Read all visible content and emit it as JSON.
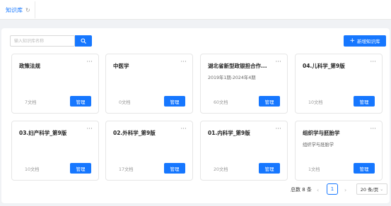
{
  "tabs": [
    {
      "label": "知识库",
      "refresh_icon": "refresh-icon"
    }
  ],
  "search": {
    "placeholder": "输入知识库名称"
  },
  "toolbar": {
    "new_label": "新增知识库"
  },
  "cards": [
    {
      "title": "政策法规",
      "description": "",
      "count": "7文档",
      "manage": "管理"
    },
    {
      "title": "中医学",
      "description": "",
      "count": "0文档",
      "manage": "管理"
    },
    {
      "title": "湖北省新型政银担合作...",
      "description": "2019年1期-2024年4期",
      "count": "60文档",
      "manage": "管理"
    },
    {
      "title": "04.儿科学_第9版",
      "description": "",
      "count": "10文档",
      "manage": "管理"
    },
    {
      "title": "03.妇产科学_第9版",
      "description": "",
      "count": "10文档",
      "manage": "管理"
    },
    {
      "title": "02.外科学_第9版",
      "description": "",
      "count": "17文档",
      "manage": "管理"
    },
    {
      "title": "01.内科学_第9版",
      "description": "",
      "count": "20文档",
      "manage": "管理"
    },
    {
      "title": "组织学与胚胎学",
      "description": "组织学与胚胎学",
      "count": "1文档",
      "manage": "管理"
    }
  ],
  "pagination": {
    "total": "总数 8 条",
    "current": "1",
    "page_size": "20 条/页"
  },
  "colors": {
    "primary": "#1677ff"
  }
}
